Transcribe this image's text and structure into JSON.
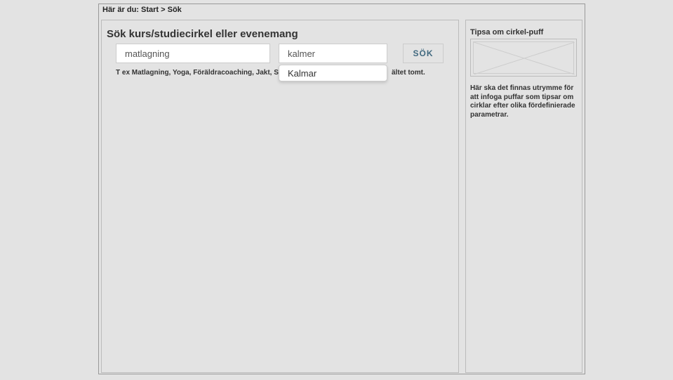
{
  "breadcrumb": {
    "prefix": "Här är du:",
    "path": "Start > Sök"
  },
  "search": {
    "title": "Sök kurs/studiecirkel eller evenemang",
    "keyword_value": "matlagning",
    "location_value": "kalmer",
    "button_label": "SÖK",
    "hint_keyword": "T ex Matlagning, Yoga, Föräldracoaching, Jakt, Spanska",
    "hint_location_tail": "ältet tomt.",
    "dropdown_value": "Kalmar"
  },
  "sidebar": {
    "title": "Tipsa om cirkel-puff",
    "description": "Här ska det finnas utrymme för att infoga puffar som tipsar om cirklar efter olika fördefinierade parametrar."
  }
}
